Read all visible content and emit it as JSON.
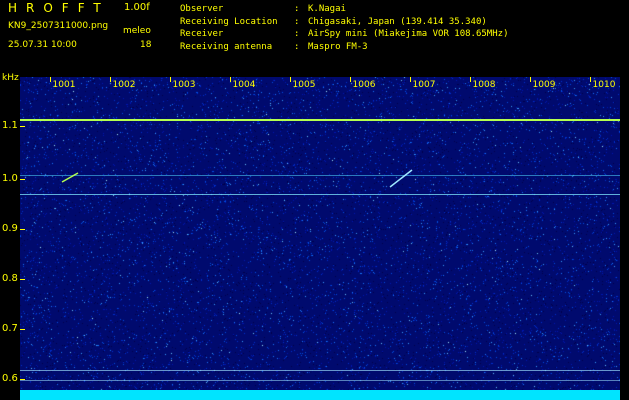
{
  "header": {
    "app_title": "HROFFT",
    "version": "1.00f",
    "filename": "KN9_2507311000.png",
    "station": "meleo",
    "datetime": "25.07.31 10:00",
    "count": "18",
    "info": [
      {
        "label": "Observer",
        "value": "K.Nagai"
      },
      {
        "label": "Receiving Location",
        "value": "Chigasaki, Japan (139.414 35.340)"
      },
      {
        "label": "Receiver",
        "value": "AirSpy mini (Miakejima VOR 108.65MHz)"
      },
      {
        "label": "Receiving antenna",
        "value": "Maspro FM-3"
      }
    ],
    "sep": ":"
  },
  "axes": {
    "y_unit": "kHz",
    "y_ticks": [
      "1.1",
      "1.0",
      "0.9",
      "0.8",
      "0.7",
      "0.6"
    ],
    "x_ticks": [
      "1001",
      "1002",
      "1003",
      "1004",
      "1005",
      "1006",
      "1007",
      "1008",
      "1009",
      "1010"
    ]
  },
  "colors": {
    "text": "#ffff00",
    "background": "#000000",
    "plot": "#000a6e",
    "carrier": "#d8ff60",
    "bottom_band": "#00e4ff"
  }
}
